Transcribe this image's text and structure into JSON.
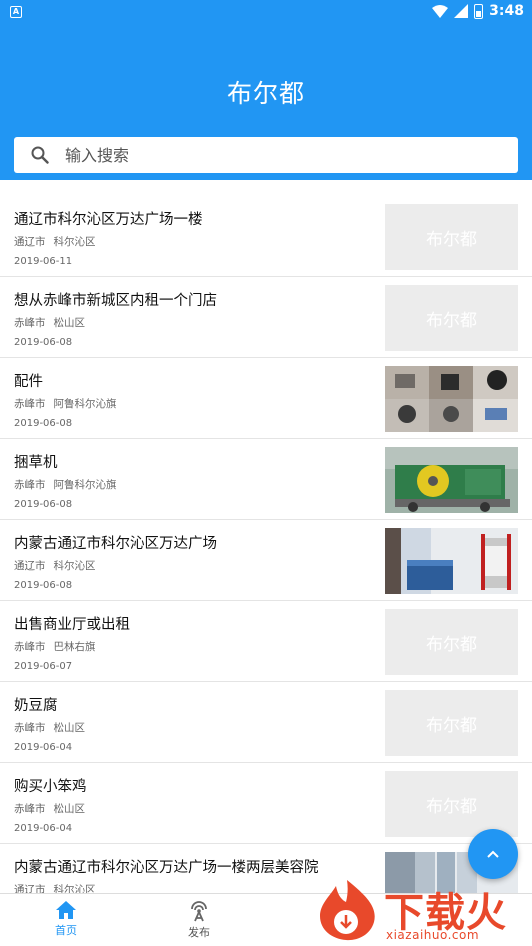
{
  "status_bar": {
    "time": "3:48"
  },
  "header": {
    "title": "布尔都"
  },
  "search": {
    "placeholder": "输入搜索"
  },
  "colors": {
    "primary": "#2196F3",
    "watermark": "#E8492B",
    "thumb_placeholder": "#ECECEC"
  },
  "listings": [
    {
      "title": "通辽市科尔沁区万达广场一楼",
      "city": "通辽市",
      "district": "科尔沁区",
      "date": "2019-06-11",
      "thumbnail": "placeholder",
      "placeholder_text": "布尔都"
    },
    {
      "title": "想从赤峰市新城区内租一个门店",
      "city": "赤峰市",
      "district": "松山区",
      "date": "2019-06-08",
      "thumbnail": "placeholder",
      "placeholder_text": "布尔都"
    },
    {
      "title": "配件",
      "city": "赤峰市",
      "district": "阿鲁科尔沁旗",
      "date": "2019-06-08",
      "thumbnail": "photo-parts"
    },
    {
      "title": "捆草机",
      "city": "赤峰市",
      "district": "阿鲁科尔沁旗",
      "date": "2019-06-08",
      "thumbnail": "photo-baler"
    },
    {
      "title": "内蒙古通辽市科尔沁区万达广场",
      "city": "通辽市",
      "district": "科尔沁区",
      "date": "2019-06-08",
      "thumbnail": "photo-salon"
    },
    {
      "title": "出售商业厅或出租",
      "city": "赤峰市",
      "district": "巴林右旗",
      "date": "2019-06-07",
      "thumbnail": "placeholder",
      "placeholder_text": "布尔都"
    },
    {
      "title": "奶豆腐",
      "city": "赤峰市",
      "district": "松山区",
      "date": "2019-06-04",
      "thumbnail": "placeholder",
      "placeholder_text": "布尔都"
    },
    {
      "title": "购买小笨鸡",
      "city": "赤峰市",
      "district": "松山区",
      "date": "2019-06-04",
      "thumbnail": "placeholder",
      "placeholder_text": "布尔都"
    },
    {
      "title": "内蒙古通辽市科尔沁区万达广场一楼两层美容院",
      "city": "通辽市",
      "district": "科尔沁区",
      "date": "",
      "thumbnail": "photo-hall"
    }
  ],
  "bottom_nav": [
    {
      "label": "首页",
      "icon": "home-icon",
      "active": true
    },
    {
      "label": "发布",
      "icon": "broadcast-icon",
      "active": false
    }
  ],
  "watermark": {
    "brand": "下载火",
    "url": "xiazaihuo.com"
  }
}
